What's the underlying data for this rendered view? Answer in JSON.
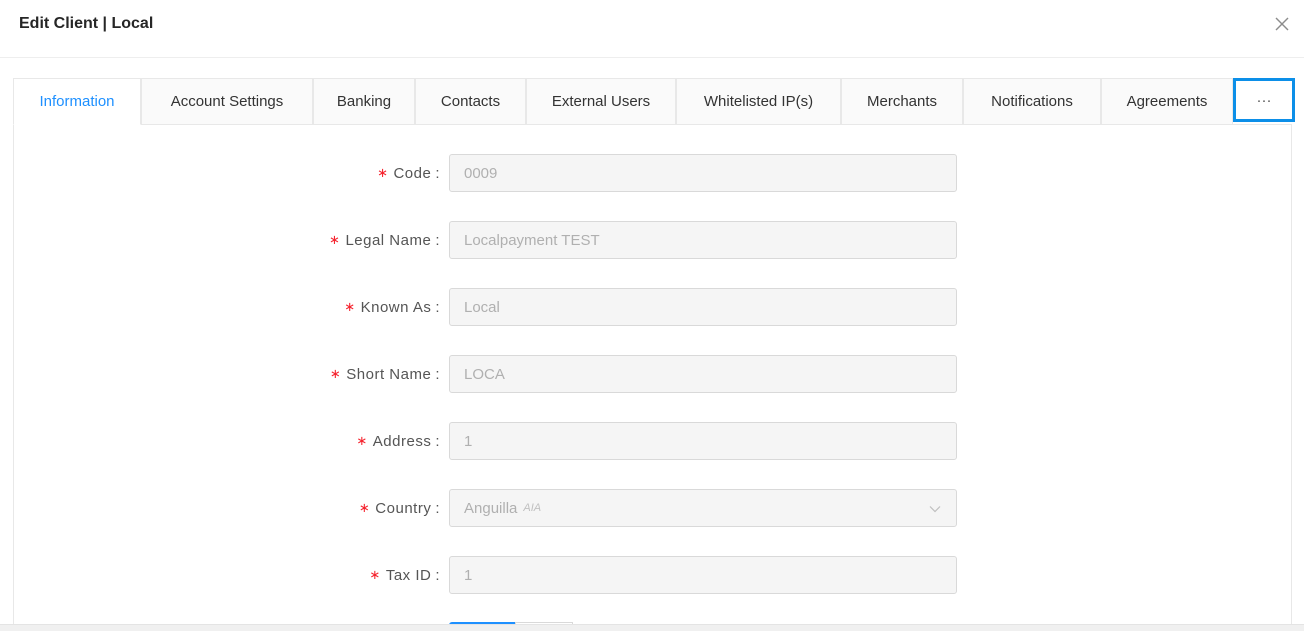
{
  "modal": {
    "title": "Edit Client | Local"
  },
  "tabs": [
    {
      "label": "Information",
      "active": true
    },
    {
      "label": "Account Settings",
      "active": false
    },
    {
      "label": "Banking",
      "active": false
    },
    {
      "label": "Contacts",
      "active": false
    },
    {
      "label": "External Users",
      "active": false
    },
    {
      "label": "Whitelisted IP(s)",
      "active": false
    },
    {
      "label": "Merchants",
      "active": false
    },
    {
      "label": "Notifications",
      "active": false
    },
    {
      "label": "Agreements",
      "active": false
    },
    {
      "label": "···",
      "active": false
    }
  ],
  "form": {
    "required_mark": "∗",
    "colon": ":",
    "fields": [
      {
        "label": "Code",
        "value": "0009"
      },
      {
        "label": "Legal Name",
        "value": "Localpayment TEST"
      },
      {
        "label": "Known As",
        "value": "Local"
      },
      {
        "label": "Short Name",
        "value": "LOCA"
      },
      {
        "label": "Address",
        "value": "1"
      },
      {
        "label": "Country",
        "value": "Anguilla",
        "sub": "AIA"
      },
      {
        "label": "Tax ID",
        "value": "1"
      }
    ]
  },
  "colors": {
    "accent": "#1e90ff",
    "highlight_border": "#0c8fe8",
    "required": "#f5222d"
  },
  "icons": {
    "close": "close-icon",
    "dropdown": "chevron-down-icon"
  }
}
